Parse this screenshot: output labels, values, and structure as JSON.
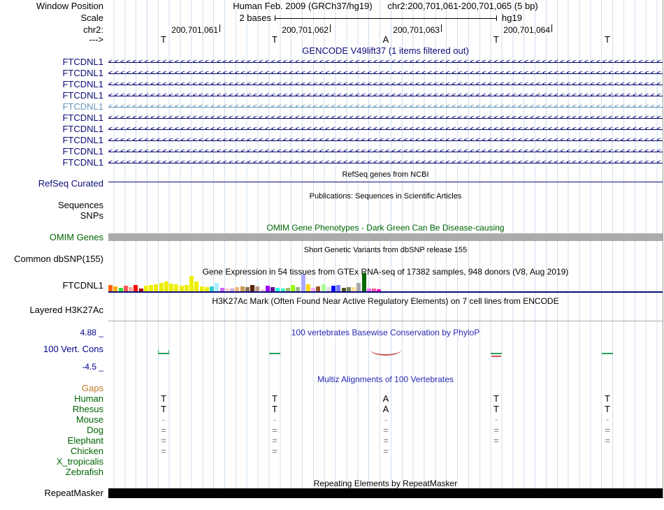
{
  "meta": {
    "navy": "#0c0c78",
    "guideline_color": "#cfdfef",
    "header_blue": "#2828b4"
  },
  "header": {
    "window_position_label": "Window Position",
    "assembly_title": "Human Feb. 2009 (GRCh37/hg19)      chr2:200,701,061-200,701,065 (5 bp)",
    "scale_label": "Scale",
    "scale_value": "2 bases",
    "scale_assembly": "hg19",
    "chrom_label": "chr2:",
    "strand_label": "--->",
    "coords": [
      "200,701,061",
      "200,701,062",
      "200,701,063",
      "200,701,064"
    ],
    "bases": [
      "T",
      "T",
      "A",
      "T",
      "T"
    ]
  },
  "gencode": {
    "title": "GENCODE V49lift37 (1 items filtered out)",
    "title_color": "#0c0c78",
    "transcripts": [
      {
        "label": "FTCDNL1",
        "color": "#0c0c78"
      },
      {
        "label": "FTCDNL1",
        "color": "#0c0c78"
      },
      {
        "label": "FTCDNL1",
        "color": "#0c0c78"
      },
      {
        "label": "FTCDNL1",
        "color": "#0c0c78"
      },
      {
        "label": "FTCDNL1",
        "color": "#6699bb"
      },
      {
        "label": "FTCDNL1",
        "color": "#0c0c78"
      },
      {
        "label": "FTCDNL1",
        "color": "#0c0c78"
      },
      {
        "label": "FTCDNL1",
        "color": "#0c0c78"
      },
      {
        "label": "FTCDNL1",
        "color": "#0c0c78"
      },
      {
        "label": "FTCDNL1",
        "color": "#0c0c78"
      }
    ]
  },
  "refseq": {
    "title": "RefSeq genes from NCBI",
    "label": "RefSeq Curated",
    "color": "#0c0c78"
  },
  "publications": {
    "title": "Publications: Sequences in Scientific Articles",
    "sequences_label": "Sequences",
    "snps_label": "SNPs"
  },
  "omim": {
    "title": "OMIM Gene Phenotypes - Dark Green Can Be Disease-causing",
    "label": "OMIM Genes",
    "color": "#006400",
    "bar_color": "#ababab"
  },
  "dbsnp": {
    "title": "Short Genetic Variants from dbSNP release 155",
    "label": "Common dbSNP(155)"
  },
  "gtex": {
    "title": "Gene Expression in 54 tissues from GTEx RNA-seq of 17382 samples, 948 donors (V8, Aug 2019)",
    "label": "FTCDNL1",
    "baseline_color": "#0c0c78",
    "chart_data": {
      "type": "bar",
      "title": "Gene Expression in 54 tissues from GTEx RNA-seq of 17382 samples, 948 donors (V8, Aug 2019)",
      "gene": "FTCDNL1",
      "values": [
        9,
        7,
        5,
        8,
        6,
        9,
        4,
        8,
        9,
        10,
        12,
        14,
        11,
        10,
        8,
        9,
        22,
        14,
        7,
        6,
        7,
        12,
        5,
        4,
        4,
        6,
        7,
        6,
        9,
        7,
        3,
        8,
        6,
        5,
        4,
        5,
        9,
        6,
        24,
        10,
        5,
        7,
        10,
        6,
        8,
        9,
        5,
        6,
        6,
        12,
        26,
        4,
        4,
        3
      ],
      "colors": [
        "#ff6600",
        "#ffaa00",
        "#33dd33",
        "#ff5555",
        "#ffaa99",
        "#ff0000",
        "#aa0000",
        "#eeee00",
        "#eeee00",
        "#eeee00",
        "#eeee00",
        "#eeee00",
        "#eeee00",
        "#eeee00",
        "#eeee00",
        "#eeee00",
        "#eeee00",
        "#eeee00",
        "#eeee00",
        "#eeee00",
        "#33cccc",
        "#aaeeff",
        "#cc66ff",
        "#ffcccc",
        "#ccaadd",
        "#eebb77",
        "#cc9955",
        "#8b7355",
        "#552200",
        "#bb9988",
        "#ffcccc",
        "#9900ff",
        "#660099",
        "#22ffdd",
        "#33ffc2",
        "#aabb66",
        "#99ff00",
        "#99bb88",
        "#aaaaff",
        "#ffd700",
        "#ffaaff",
        "#995522",
        "#aaff99",
        "#dddddd",
        "#0000ff",
        "#7777ff",
        "#555522",
        "#778855",
        "#ffdd99",
        "#aaaaaa",
        "#006600",
        "#ff66ff",
        "#ff5599",
        "#ff00bb"
      ]
    }
  },
  "h3k27ac": {
    "title": "H3K27Ac Mark (Often Found Near Active Regulatory Elements) on 7 cell lines from ENCODE",
    "label": "Layered H3K27Ac"
  },
  "conservation": {
    "title": "100 vertebrates Basewise Conservation by PhyloP",
    "label": "100 Vert. Cons",
    "max_label": "4.88 _",
    "min_label": "-4.5 _",
    "label_color": "#00008b",
    "pos_color": "#2ca05a",
    "neg_color": "#cc5555"
  },
  "multiz": {
    "title": "Multiz Alignments of 100 Vertebrates",
    "rows": [
      {
        "name": "Gaps",
        "name_color": "#c07828",
        "base_color": "#777777",
        "bases": [
          "",
          "",
          "",
          "",
          ""
        ]
      },
      {
        "name": "Human",
        "name_color": "#006400",
        "base_color": "#000000",
        "bases": [
          "T",
          "T",
          "A",
          "T",
          "T"
        ]
      },
      {
        "name": "Rhesus",
        "name_color": "#006400",
        "base_color": "#000000",
        "bases": [
          "T",
          "T",
          "A",
          "T",
          "T"
        ]
      },
      {
        "name": "Mouse",
        "name_color": "#006400",
        "base_color": "#999999",
        "bases": [
          "-",
          "-",
          "-",
          "-",
          "-"
        ]
      },
      {
        "name": "Dog",
        "name_color": "#006400",
        "base_color": "#777777",
        "bases": [
          "=",
          "=",
          "=",
          "=",
          "="
        ]
      },
      {
        "name": "Elephant",
        "name_color": "#006400",
        "base_color": "#777777",
        "bases": [
          "=",
          "=",
          "=",
          "=",
          "="
        ]
      },
      {
        "name": "Chicken",
        "name_color": "#006400",
        "base_color": "#777777",
        "bases": [
          "=",
          "=",
          "=",
          "",
          ""
        ]
      },
      {
        "name": "X_tropicalis",
        "name_color": "#006400",
        "base_color": "#777777",
        "bases": [
          "",
          "",
          "",
          "",
          ""
        ]
      },
      {
        "name": "Zebrafish",
        "name_color": "#006400",
        "base_color": "#777777",
        "bases": [
          "",
          "",
          "",
          "",
          ""
        ]
      }
    ]
  },
  "repeatmasker": {
    "title": "Repeating Elements by RepeatMasker",
    "label": "RepeatMasker",
    "bar_color": "#000000"
  }
}
